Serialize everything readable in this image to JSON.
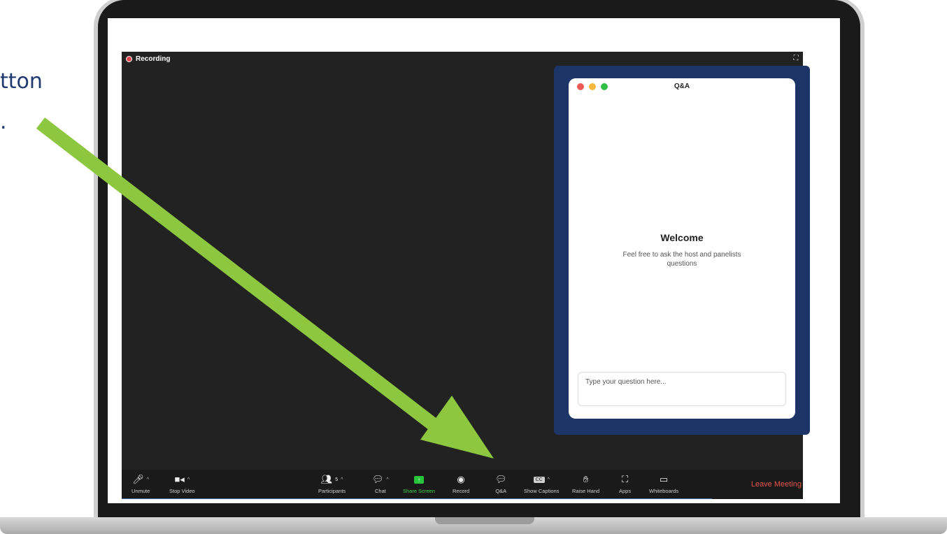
{
  "caption": {
    "line1": "tton",
    "line2": "."
  },
  "zoom": {
    "recording_label": "Recording",
    "qa": {
      "title": "Q&A",
      "welcome": "Welcome",
      "subtitle": "Feel free to ask the host and panelists questions",
      "input_placeholder": "Type your question here..."
    },
    "toolbar": {
      "unmute": "Unmute",
      "stop_video": "Stop Video",
      "participants": "Participants",
      "participants_count": "5",
      "chat": "Chat",
      "share_screen": "Share Screen",
      "record": "Record",
      "qa": "Q&A",
      "show_captions": "Show Captions",
      "raise_hand": "Raise Hand",
      "apps": "Apps",
      "whiteboards": "Whiteboards",
      "leave": "Leave Meeting",
      "cc_badge": "CC"
    }
  },
  "colors": {
    "arrow": "#8dc63f",
    "qa_panel": "#1c3566",
    "caption": "#1e3a6e",
    "leave": "#e0544b",
    "share": "#26c53b"
  }
}
